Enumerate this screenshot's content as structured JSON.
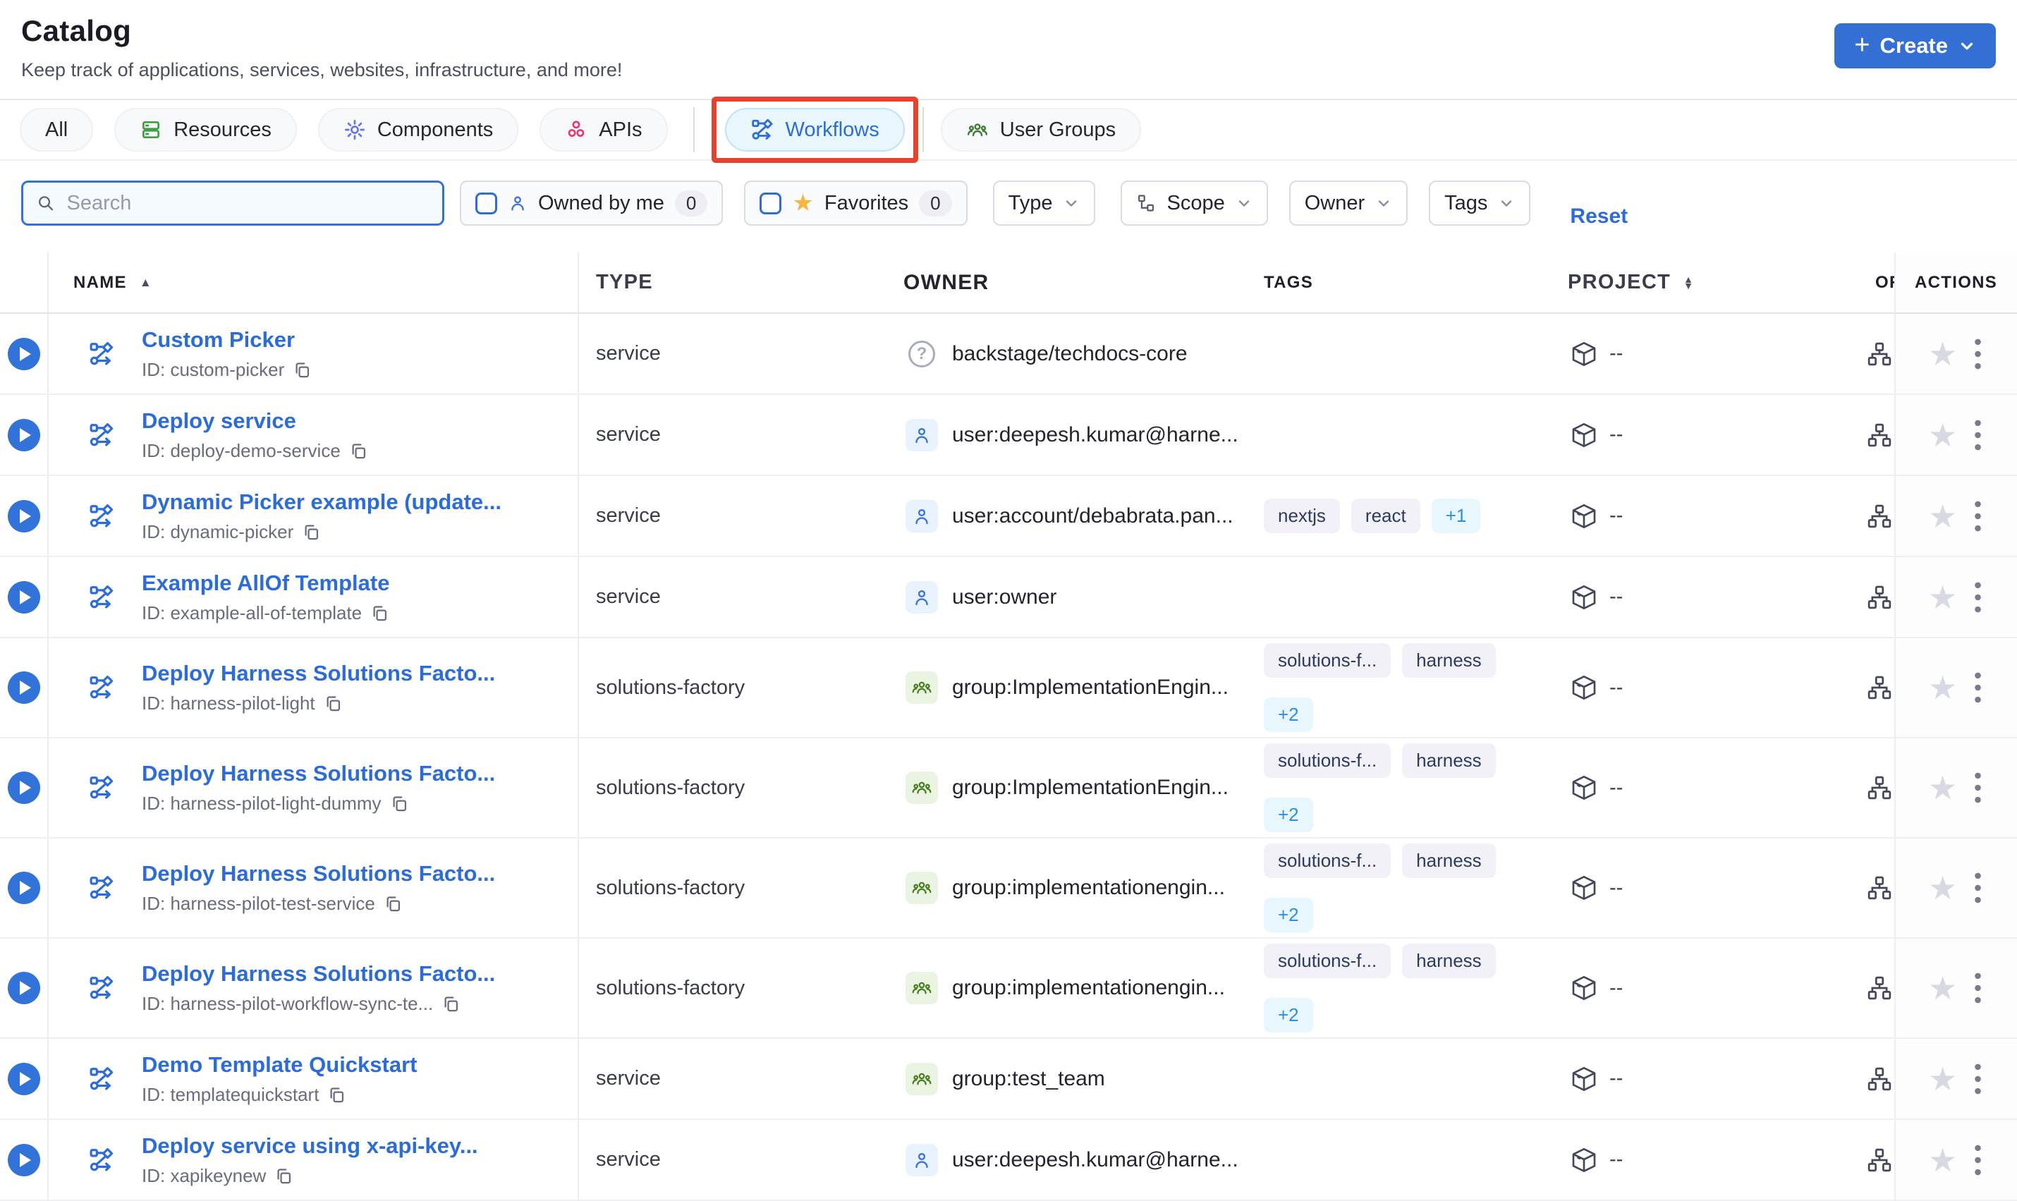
{
  "page": {
    "title": "Catalog",
    "subtitle": "Keep track of applications, services, websites, infrastructure, and more!"
  },
  "create_button": {
    "label": "Create"
  },
  "tabs": [
    {
      "label": "All"
    },
    {
      "label": "Resources"
    },
    {
      "label": "Components"
    },
    {
      "label": "APIs"
    },
    {
      "label": "Workflows",
      "active": true,
      "annotated": true
    },
    {
      "label": "User Groups"
    }
  ],
  "filters": {
    "search": {
      "placeholder": "Search",
      "value": ""
    },
    "owned_by_me": {
      "label": "Owned by me",
      "count": "0",
      "checked": false
    },
    "favorites": {
      "label": "Favorites",
      "count": "0",
      "checked": false
    },
    "type": {
      "label": "Type"
    },
    "scope": {
      "label": "Scope"
    },
    "owner": {
      "label": "Owner"
    },
    "tags": {
      "label": "Tags"
    },
    "reset": {
      "label": "Reset"
    }
  },
  "table": {
    "headers": {
      "name": "NAME",
      "type": "TYPE",
      "owner": "OWNER",
      "tags": "TAGS",
      "project": "PROJECT",
      "org": "OR",
      "actions": "ACTIONS"
    },
    "rows": [
      {
        "name": "Custom Picker",
        "id": "ID: custom-picker",
        "type": "service",
        "owner": "backstage/techdocs-core",
        "owner_icon": "help",
        "tags": [],
        "more_tag": "",
        "more_on_new_line": false,
        "tall": false,
        "project": "--"
      },
      {
        "name": "Deploy service",
        "id": "ID: deploy-demo-service",
        "type": "service",
        "owner": "user:deepesh.kumar@harne...",
        "owner_icon": "user",
        "tags": [],
        "more_tag": "",
        "more_on_new_line": false,
        "tall": false,
        "project": "--"
      },
      {
        "name": "Dynamic Picker example (update...",
        "id": "ID: dynamic-picker",
        "type": "service",
        "owner": "user:account/debabrata.pan...",
        "owner_icon": "user",
        "tags": [
          "nextjs",
          "react"
        ],
        "more_tag": "+1",
        "more_on_new_line": false,
        "tall": false,
        "project": "--"
      },
      {
        "name": "Example AllOf Template",
        "id": "ID: example-all-of-template",
        "type": "service",
        "owner": "user:owner",
        "owner_icon": "user",
        "tags": [],
        "more_tag": "",
        "more_on_new_line": false,
        "tall": false,
        "project": "--"
      },
      {
        "name": "Deploy Harness Solutions Facto...",
        "id": "ID: harness-pilot-light",
        "type": "solutions-factory",
        "owner": "group:ImplementationEngin...",
        "owner_icon": "group",
        "tags": [
          "solutions-f...",
          "harness"
        ],
        "more_tag": "+2",
        "more_on_new_line": true,
        "tall": true,
        "project": "--"
      },
      {
        "name": "Deploy Harness Solutions Facto...",
        "id": "ID: harness-pilot-light-dummy",
        "type": "solutions-factory",
        "owner": "group:ImplementationEngin...",
        "owner_icon": "group",
        "tags": [
          "solutions-f...",
          "harness"
        ],
        "more_tag": "+2",
        "more_on_new_line": true,
        "tall": true,
        "project": "--"
      },
      {
        "name": "Deploy Harness Solutions Facto...",
        "id": "ID: harness-pilot-test-service",
        "type": "solutions-factory",
        "owner": "group:implementationengin...",
        "owner_icon": "group",
        "tags": [
          "solutions-f...",
          "harness"
        ],
        "more_tag": "+2",
        "more_on_new_line": true,
        "tall": true,
        "project": "--"
      },
      {
        "name": "Deploy Harness Solutions Facto...",
        "id": "ID: harness-pilot-workflow-sync-te...",
        "type": "solutions-factory",
        "owner": "group:implementationengin...",
        "owner_icon": "group",
        "tags": [
          "solutions-f...",
          "harness"
        ],
        "more_tag": "+2",
        "more_on_new_line": true,
        "tall": true,
        "project": "--"
      },
      {
        "name": "Demo Template Quickstart",
        "id": "ID: templatequickstart",
        "type": "service",
        "owner": "group:test_team",
        "owner_icon": "group",
        "tags": [],
        "more_tag": "",
        "more_on_new_line": false,
        "tall": false,
        "project": "--"
      },
      {
        "name": "Deploy service using x-api-key...",
        "id": "ID: xapikeynew",
        "type": "service",
        "owner": "user:deepesh.kumar@harne...",
        "owner_icon": "user",
        "tags": [],
        "more_tag": "",
        "more_on_new_line": false,
        "tall": false,
        "project": "--"
      }
    ]
  },
  "colors": {
    "primary_blue": "#3470d4",
    "link_blue": "#2b6cd9",
    "annotation_red": "#e8412d",
    "active_tab_bg": "#e9f7fd",
    "active_tab_border": "#bfe3f6",
    "tag_bg": "#f1f1f7",
    "tag_text": "#2c3c60",
    "more_tag_bg": "#e8f6fd",
    "more_tag_text": "#2f8fdf",
    "star_yellow": "#f5b73f",
    "inactive_star": "#d8dae3",
    "checkbox_blue": "#2e6fd6",
    "search_border": "#3273d9"
  }
}
